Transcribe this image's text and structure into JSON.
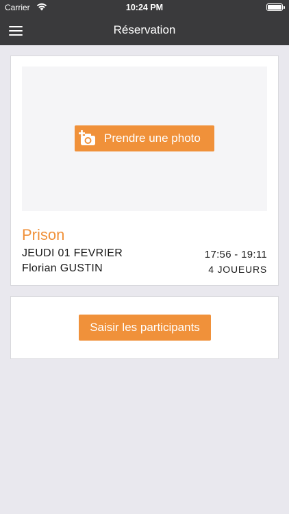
{
  "statusbar": {
    "carrier": "Carrier",
    "time": "10:24 PM",
    "wifi_icon": "wifi-icon",
    "battery_icon": "battery-icon",
    "battery_level": 1.0
  },
  "navbar": {
    "title": "Réservation",
    "menu_icon": "hamburger-menu-icon"
  },
  "reservation": {
    "photo_button_label": "Prendre une photo",
    "photo_button_icon": "add-camera-icon",
    "title": "Prison",
    "date": "JEUDI 01 FEVRIER",
    "time": "17:56 - 19:11",
    "name": "Florian GUSTIN",
    "players": "4 JOUEURS"
  },
  "participants": {
    "button_label": "Saisir les participants"
  },
  "colors": {
    "accent": "#f0913a",
    "bar": "#3a3a3c",
    "background": "#e9e8ee"
  }
}
